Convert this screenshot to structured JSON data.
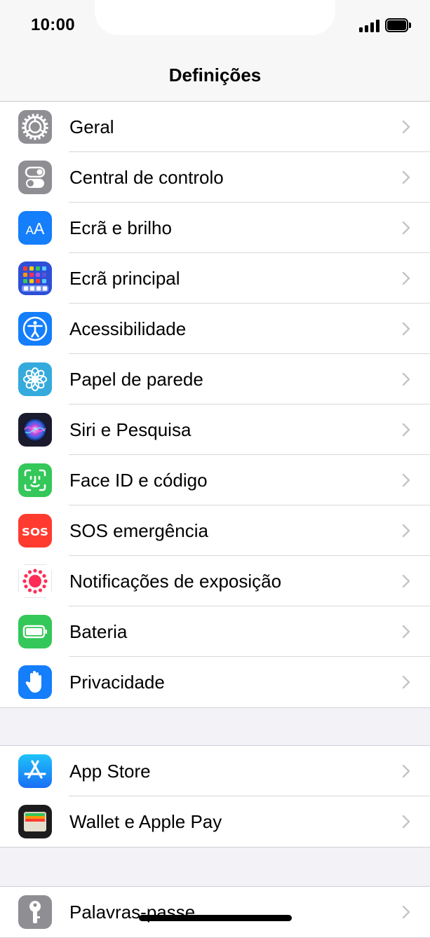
{
  "status": {
    "time": "10:00"
  },
  "nav": {
    "title": "Definições"
  },
  "groups": [
    {
      "items": [
        {
          "label": "Geral",
          "icon": "gear-icon",
          "color": "#8e8e93"
        },
        {
          "label": "Central de controlo",
          "icon": "toggles-icon",
          "color": "#8e8e93"
        },
        {
          "label": "Ecrã e brilho",
          "icon": "text-size-icon",
          "color": "#147efb"
        },
        {
          "label": "Ecrã principal",
          "icon": "app-grid-icon",
          "color": "#2d4fd8"
        },
        {
          "label": "Acessibilidade",
          "icon": "accessibility-icon",
          "color": "#147efb"
        },
        {
          "label": "Papel de parede",
          "icon": "flower-icon",
          "color": "#35aadc"
        },
        {
          "label": "Siri e Pesquisa",
          "icon": "siri-icon",
          "color": "#1b1b2e"
        },
        {
          "label": "Face ID e código",
          "icon": "face-id-icon",
          "color": "#34c759"
        },
        {
          "label": "SOS emergência",
          "icon": "sos-icon",
          "color": "#ff3b30",
          "icon_text": "SOS"
        },
        {
          "label": "Notificações de exposição",
          "icon": "exposure-icon",
          "color": "#ffffff"
        },
        {
          "label": "Bateria",
          "icon": "battery-icon",
          "color": "#34c759"
        },
        {
          "label": "Privacidade",
          "icon": "hand-icon",
          "color": "#147efb"
        }
      ]
    },
    {
      "items": [
        {
          "label": "App Store",
          "icon": "app-store-icon",
          "color": "#1c8ef9"
        },
        {
          "label": "Wallet e Apple Pay",
          "icon": "wallet-icon",
          "color": "#1c1c1e"
        }
      ]
    },
    {
      "items": [
        {
          "label": "Palavras-passe",
          "icon": "key-icon",
          "color": "#8e8e93"
        }
      ]
    }
  ]
}
